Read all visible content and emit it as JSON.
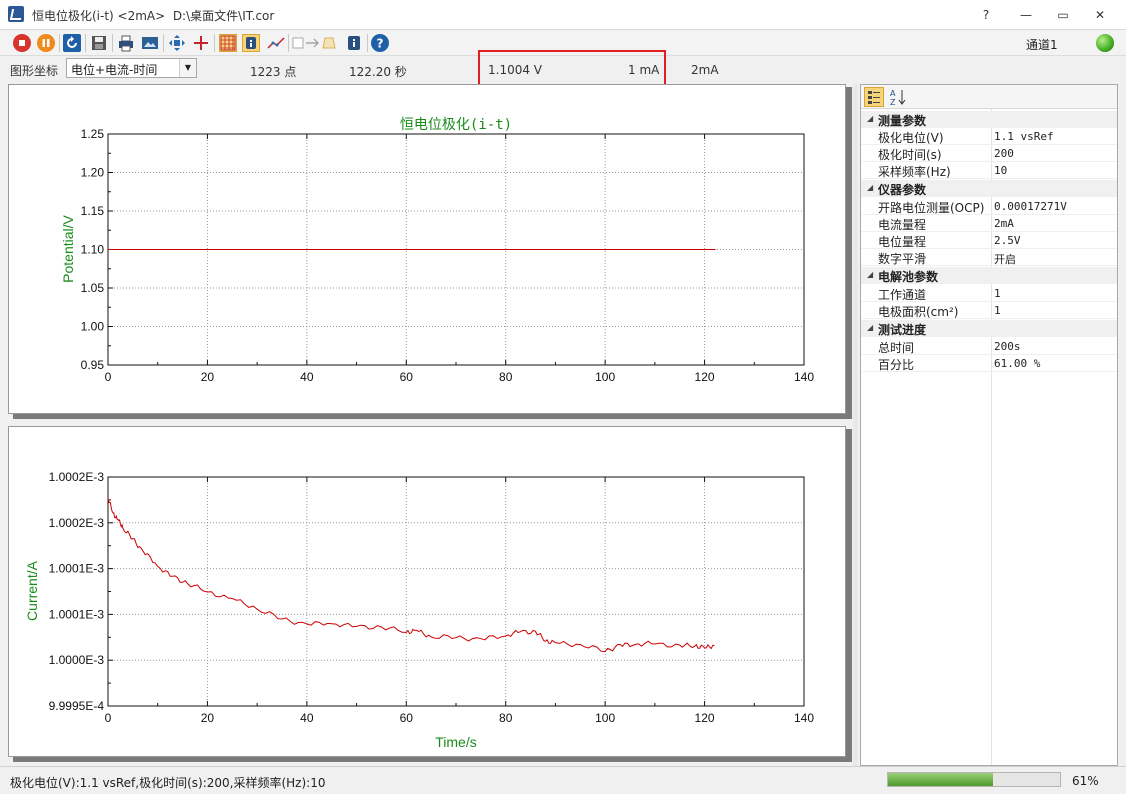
{
  "window": {
    "title": "恒电位极化(i-t) <2mA>  D:\\桌面文件\\IT.cor",
    "help_label": "?",
    "minimize_label": "—",
    "maximize_label": "▭",
    "close_label": "✕"
  },
  "toolbar": {
    "channel_label": "通道1",
    "icons": [
      "stop-icon",
      "pause-icon",
      "refresh-icon",
      "save-icon",
      "print-icon",
      "image-icon",
      "zoom-fit-icon",
      "crosshair-icon",
      "grid-icon",
      "info-tool-icon",
      "curve-icon",
      "arrow-icon",
      "clear-icon",
      "info-icon",
      "help-icon"
    ]
  },
  "infobar": {
    "axis_label": "图形坐标",
    "axis_select": "电位+电流-时间",
    "points": "1223 点",
    "seconds": "122.20 秒",
    "potential": "1.1004 V",
    "current": "1 mA",
    "range": "2mA"
  },
  "chart_data": [
    {
      "type": "line",
      "title": "恒电位极化(i-t)",
      "xlabel": "",
      "ylabel": "Potential/V",
      "xlim": [
        0,
        140
      ],
      "ylim": [
        0.95,
        1.25
      ],
      "x_ticks": [
        "0",
        "20",
        "40",
        "60",
        "80",
        "100",
        "120",
        "140"
      ],
      "y_ticks": [
        "0.95",
        "1.00",
        "1.05",
        "1.10",
        "1.15",
        "1.20",
        "1.25"
      ],
      "grid": true,
      "series": [
        {
          "color": "#cc0000",
          "x": [
            0,
            122.2
          ],
          "y": [
            1.1,
            1.1
          ]
        }
      ]
    },
    {
      "type": "line",
      "title": "",
      "xlabel": "Time/s",
      "ylabel": "Current/A",
      "xlim": [
        0,
        140
      ],
      "ylim": [
        0.99995,
        1.0002
      ],
      "x_ticks": [
        "0",
        "20",
        "40",
        "60",
        "80",
        "100",
        "120",
        "140"
      ],
      "y_ticks": [
        "9.9995E-4",
        "1.0000E-3",
        "1.0001E-3",
        "1.0001E-3",
        "1.0002E-3",
        "1.0002E-3"
      ],
      "grid": true,
      "series": [
        {
          "color": "#cc0000",
          "x": [
            0,
            1,
            2,
            3,
            5,
            7,
            10,
            13,
            16,
            20,
            25,
            30,
            35,
            40,
            45,
            50,
            55,
            60,
            62,
            65,
            70,
            75,
            80,
            83,
            86,
            88,
            90,
            95,
            100,
            103,
            106,
            110,
            115,
            118,
            120,
            122
          ],
          "y": [
            1.000177,
            1.000162,
            1.000152,
            1.000145,
            1.000133,
            1.000118,
            1.000104,
            1.000091,
            1.000083,
            1.000076,
            1.000066,
            1.000056,
            1.000046,
            1.000038,
            1.000041,
            1.000037,
            1.000035,
            1.000032,
            1.000032,
            1.000025,
            1.000026,
            1.000022,
            1.000027,
            1.000032,
            1.00003,
            1.000022,
            1.000019,
            1.000016,
            1.000011,
            1.000016,
            1.000017,
            1.000019,
            1.000015,
            1.000016,
            1.000014,
            1.000016
          ]
        }
      ]
    }
  ],
  "properties": {
    "sort_icons": [
      "categorized-icon",
      "alphabetical-icon"
    ],
    "categories": [
      {
        "name": "测量参数",
        "rows": [
          {
            "key": "极化电位(V)",
            "value": "1.1 vsRef"
          },
          {
            "key": "极化时间(s)",
            "value": "200"
          },
          {
            "key": "采样频率(Hz)",
            "value": "10"
          }
        ]
      },
      {
        "name": "仪器参数",
        "rows": [
          {
            "key": "开路电位测量(OCP)",
            "value": "0.00017271V"
          },
          {
            "key": "电流量程",
            "value": "2mA"
          },
          {
            "key": "电位量程",
            "value": "2.5V"
          },
          {
            "key": "数字平滑",
            "value": "开启"
          }
        ]
      },
      {
        "name": "电解池参数",
        "rows": [
          {
            "key": "工作通道",
            "value": "1"
          },
          {
            "key": "电极面积(cm²)",
            "value": "1"
          }
        ]
      },
      {
        "name": "测试进度",
        "rows": [
          {
            "key": "总时间",
            "value": "200s"
          },
          {
            "key": "百分比",
            "value": "61.00 %"
          }
        ]
      }
    ]
  },
  "statusbar": {
    "text": "极化电位(V):1.1 vsRef,极化时间(s):200,采样频率(Hz):10",
    "progress": 0.61,
    "progress_label": "61%"
  }
}
